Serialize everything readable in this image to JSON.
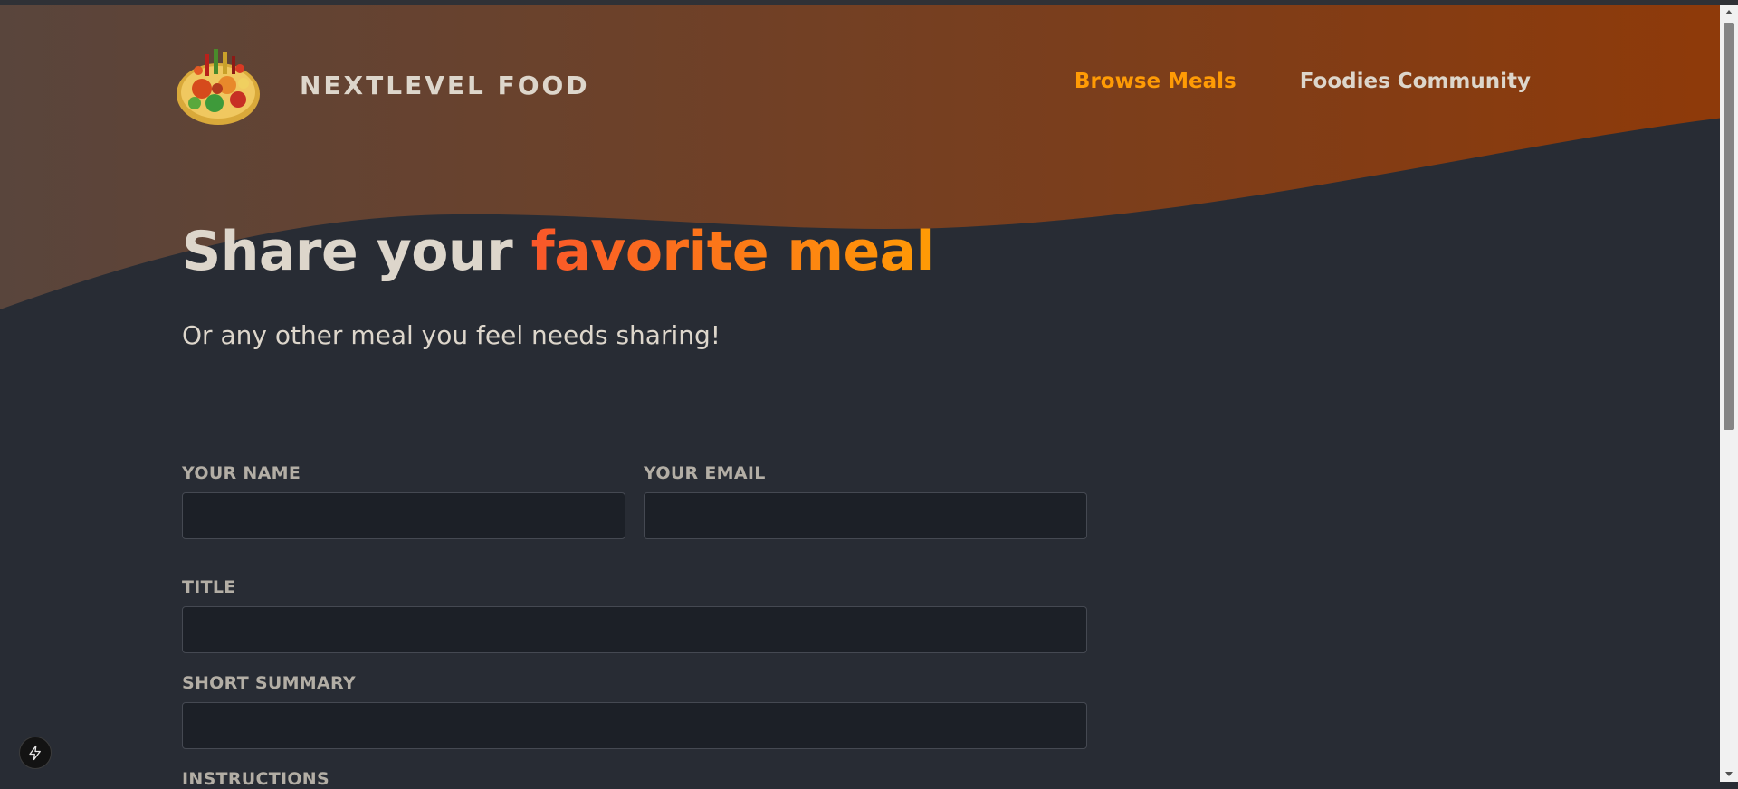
{
  "brand": {
    "logo_alt": "A plate with food on it",
    "name": "NextLevel Food"
  },
  "nav": {
    "items": [
      {
        "label": "Browse Meals",
        "active": true
      },
      {
        "label": "Foodies Community",
        "active": false
      }
    ]
  },
  "hero": {
    "title_plain": "Share your ",
    "title_highlight": "favorite meal",
    "subtitle": "Or any other meal you feel needs sharing!"
  },
  "form": {
    "name_label": "Your name",
    "name_value": "",
    "email_label": "Your email",
    "email_value": "",
    "title_label": "Title",
    "title_value": "",
    "summary_label": "Short Summary",
    "summary_value": "",
    "instructions_label": "Instructions"
  },
  "dev_indicator": {
    "icon": "lightning-bolt-icon"
  },
  "colors": {
    "background": "#282c34",
    "header_gradient_start": "#59453c",
    "header_gradient_end": "#8f3a09",
    "accent_orange": "#ff9b05",
    "accent_red": "#f9572a",
    "text": "#ddd6cb",
    "input_bg": "#1c2027"
  }
}
